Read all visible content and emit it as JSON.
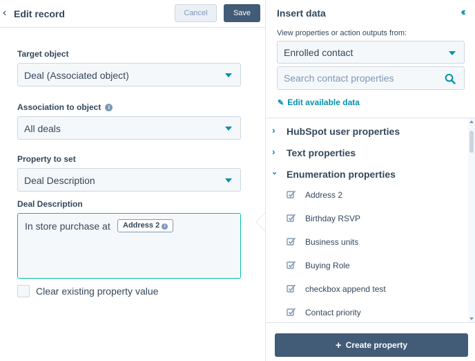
{
  "header": {
    "title": "Edit record",
    "cancel_label": "Cancel",
    "save_label": "Save"
  },
  "form": {
    "target_object": {
      "label": "Target object",
      "value": "Deal (Associated object)"
    },
    "association": {
      "label": "Association to object",
      "value": "All deals"
    },
    "property": {
      "label": "Property to set",
      "value": "Deal Description"
    },
    "description": {
      "label": "Deal Description",
      "text": "In store purchase at",
      "token": "Address 2"
    },
    "clear_checkbox": {
      "label": "Clear existing property value",
      "checked": false
    }
  },
  "insert_panel": {
    "title": "Insert data",
    "subtitle": "View properties or action outputs from:",
    "source": "Enrolled contact",
    "search_placeholder": "Search contact properties",
    "edit_link": "Edit available data",
    "groups": [
      {
        "label": "HubSpot user properties",
        "expanded": false
      },
      {
        "label": "Text properties",
        "expanded": false
      },
      {
        "label": "Enumeration properties",
        "expanded": true
      }
    ],
    "properties": [
      "Address 2",
      "Birthday RSVP",
      "Business units",
      "Buying Role",
      "checkbox append test",
      "Contact priority"
    ],
    "create_button": "Create property"
  },
  "icons": {
    "back": "chevron-left-icon",
    "collapse": "double-chevron-left-icon",
    "search": "search-icon",
    "edit": "pencil-icon",
    "property": "checkbox-list-icon",
    "info": "info-icon"
  },
  "colors": {
    "primary_dark": "#425b76",
    "accent_teal": "#0091ae",
    "active_border": "#00bda5",
    "text": "#33475b",
    "input_bg": "#f5f8fa",
    "border": "#cbd6e2"
  }
}
